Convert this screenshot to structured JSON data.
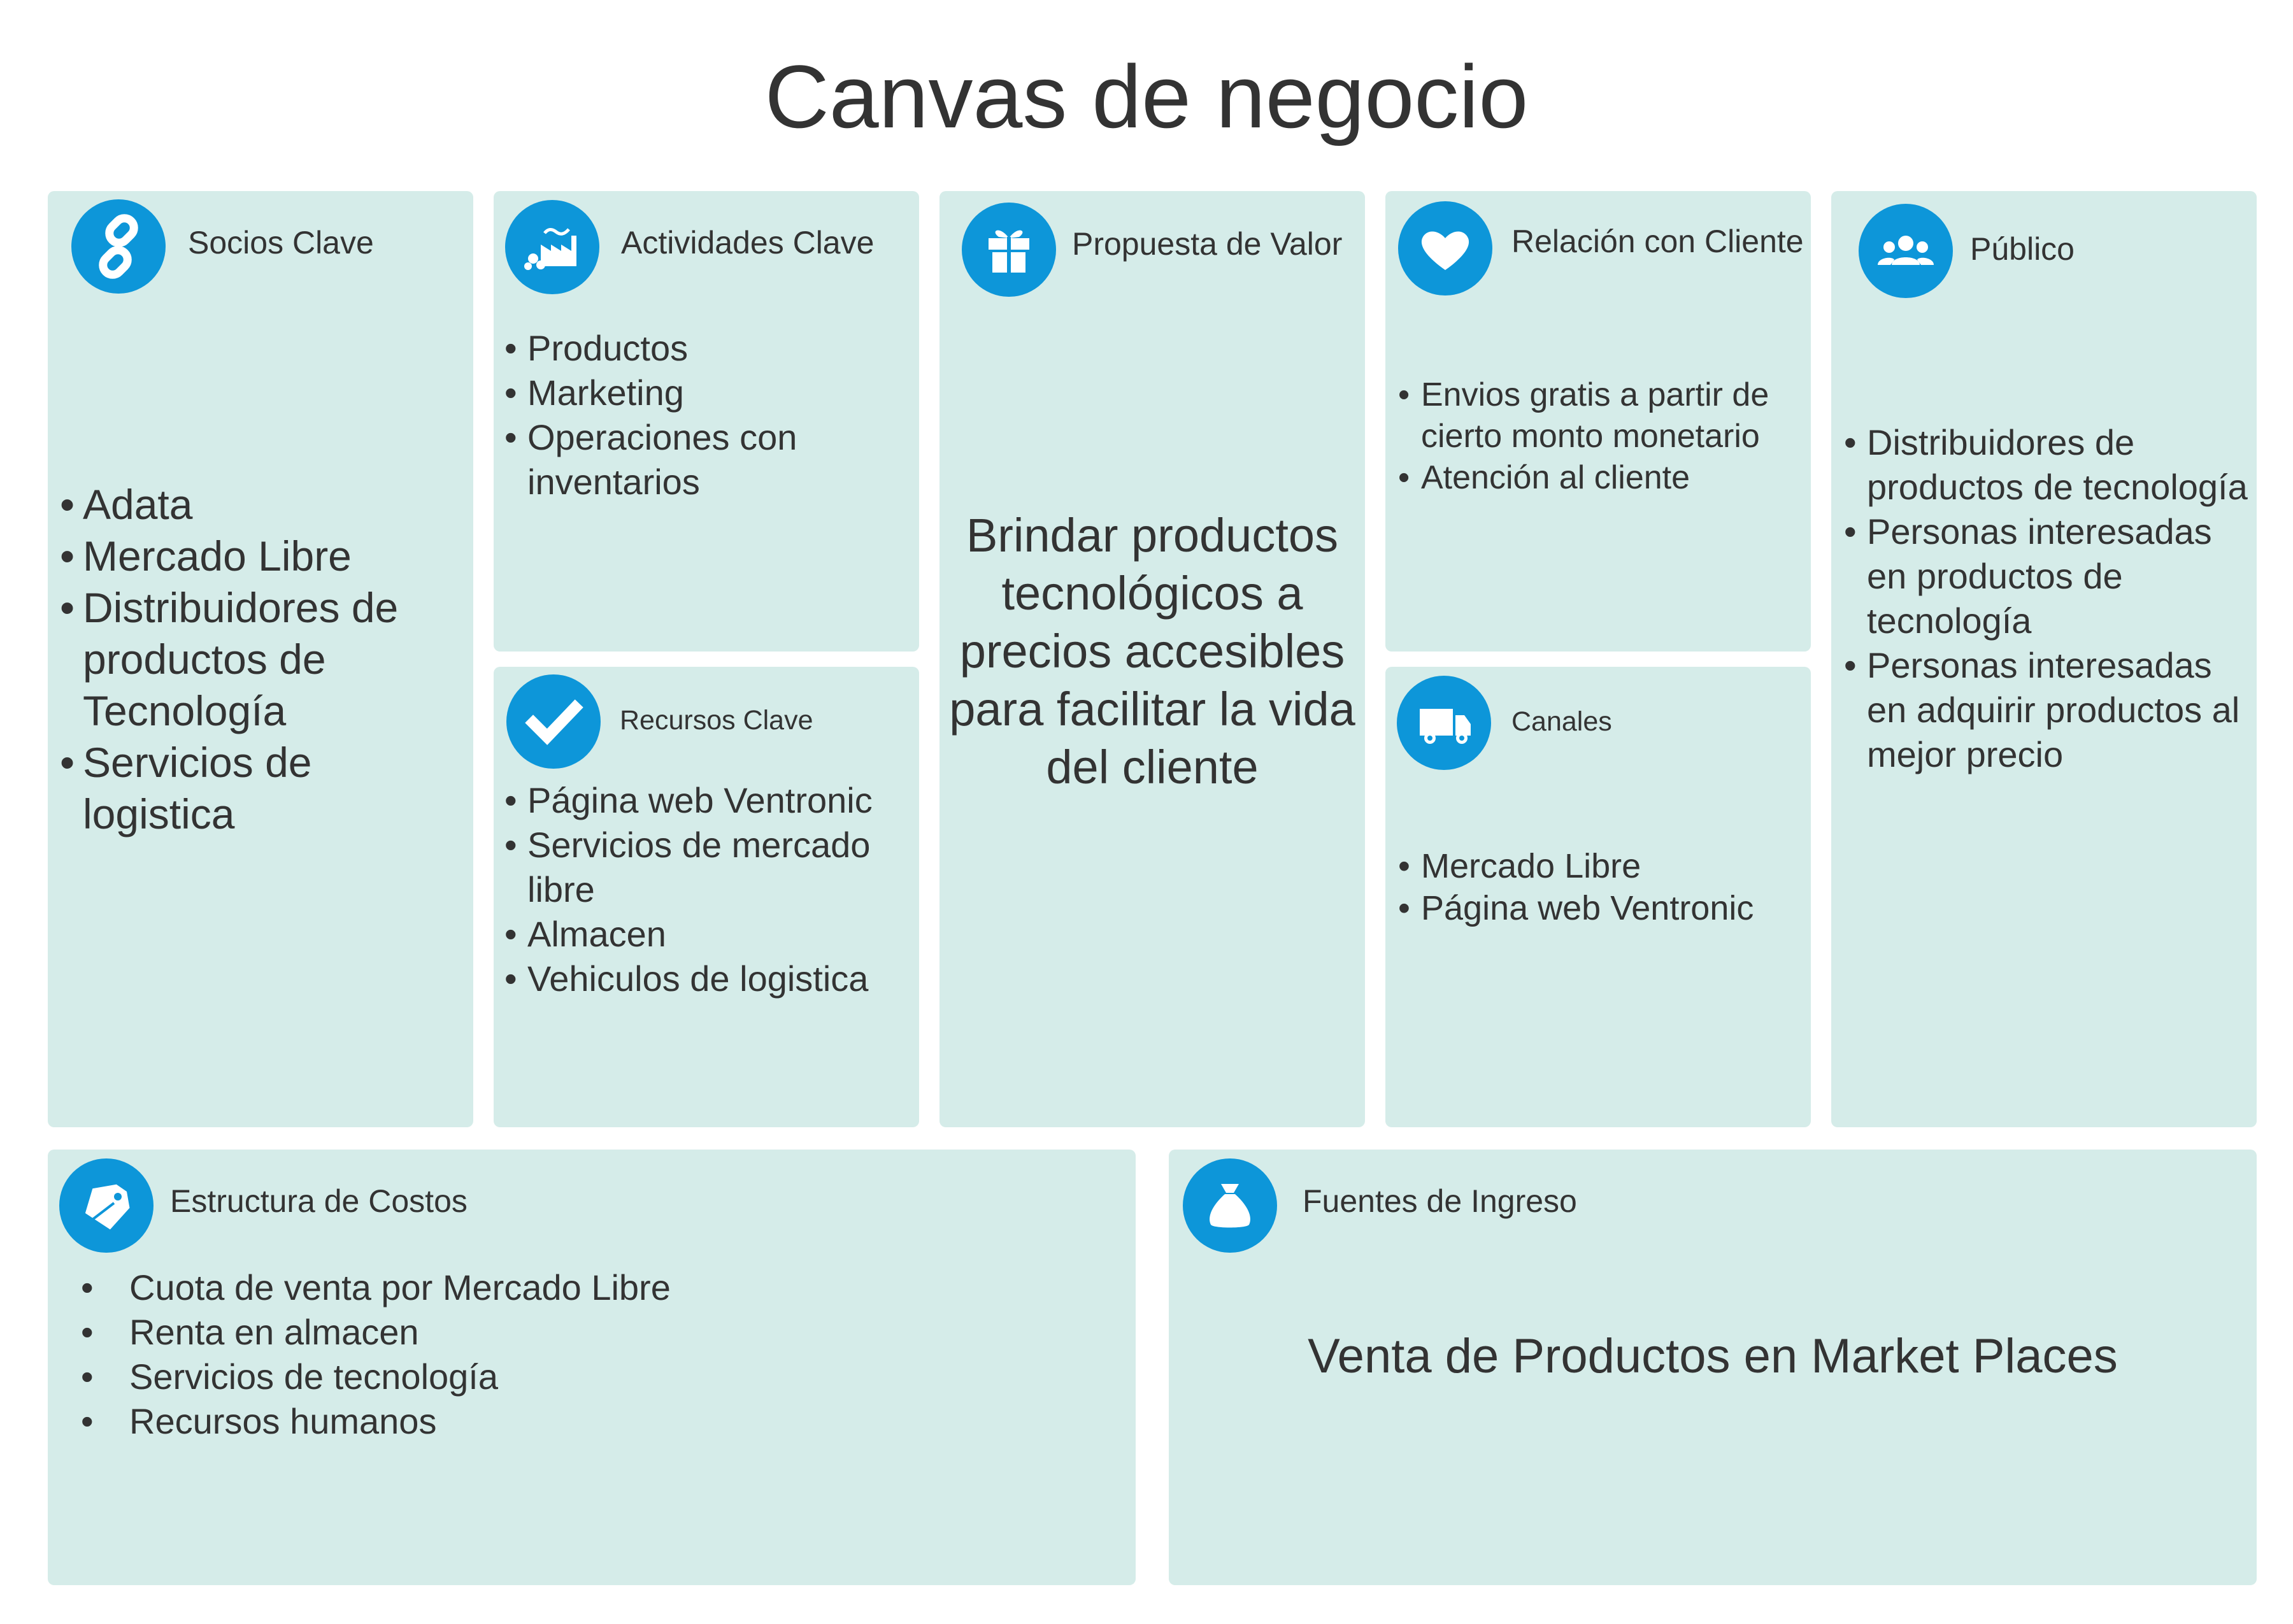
{
  "title": "Canvas de negocio",
  "colors": {
    "box_bg": "#d5ece9",
    "icon_bg": "#0d96d9",
    "text": "#333333"
  },
  "socios_clave": {
    "header": "Socios Clave",
    "icon": "link-icon",
    "items": [
      "Adata",
      "Mercado Libre",
      "Distribuidores de productos de Tecnología",
      "Servicios de logistica"
    ]
  },
  "actividades_clave": {
    "header": "Actividades Clave",
    "icon": "factory-icon",
    "items": [
      "Productos",
      "Marketing",
      "Operaciones con inventarios"
    ]
  },
  "recursos_clave": {
    "header": "Recursos Clave",
    "icon": "checkmark-icon",
    "items": [
      "Página web Ventronic",
      "Servicios de mercado libre",
      "Almacen",
      "Vehiculos de logistica"
    ]
  },
  "propuesta_valor": {
    "header": "Propuesta de Valor",
    "icon": "gift-icon",
    "text": "Brindar productos tecnológicos a precios accesibles para facilitar la vida del cliente"
  },
  "relacion_cliente": {
    "header": "Relación con Cliente",
    "icon": "heart-icon",
    "items": [
      "Envios gratis a partir de cierto monto monetario",
      "Atención al cliente"
    ]
  },
  "canales": {
    "header": "Canales",
    "icon": "truck-icon",
    "items": [
      "Mercado Libre",
      "Página web Ventronic"
    ]
  },
  "publico": {
    "header": "Público",
    "icon": "people-icon",
    "items": [
      " Distribuidores de productos de tecnología",
      "Personas interesadas en productos de tecnología",
      "Personas interesadas en adquirir productos al mejor precio"
    ]
  },
  "estructura_costos": {
    "header": "Estructura de Costos",
    "icon": "tag-icon",
    "items": [
      "Cuota de venta por Mercado Libre",
      "Renta en almacen",
      "Servicios de tecnología",
      "Recursos humanos"
    ]
  },
  "fuentes_ingreso": {
    "header": "Fuentes de Ingreso",
    "icon": "money-bag-icon",
    "text": "Venta de Productos en Market Places"
  }
}
